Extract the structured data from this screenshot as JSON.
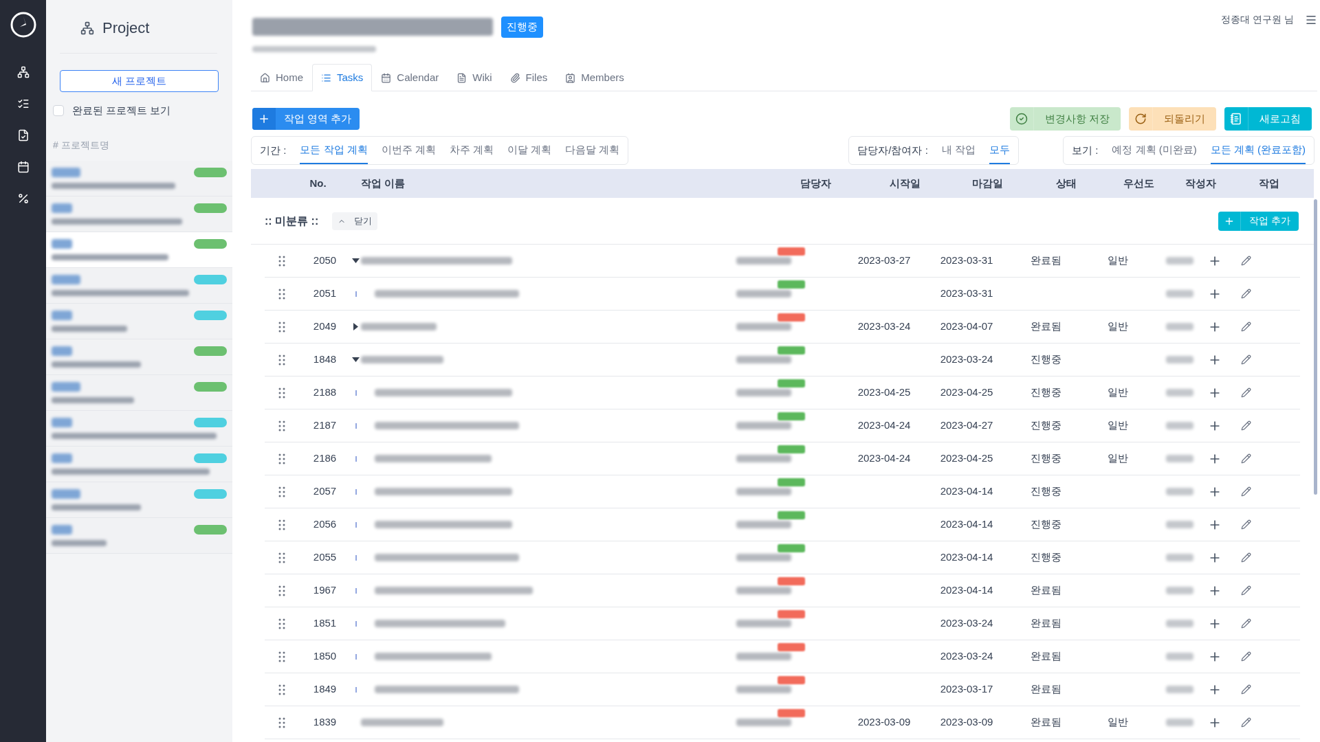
{
  "sidebar": {
    "title": "Project",
    "new_button": "새 프로젝트",
    "show_completed": {
      "label": "완료된 프로젝트 보기",
      "checked": false
    },
    "section": "# 프로젝트명",
    "projects": [
      {
        "color": "#6cc070",
        "selected": false
      },
      {
        "color": "#6cc070",
        "selected": false
      },
      {
        "color": "#6cc070",
        "selected": true
      },
      {
        "color": "#4fd0e0",
        "selected": false
      },
      {
        "color": "#4fd0e0",
        "selected": false
      },
      {
        "color": "#6cc070",
        "selected": false
      },
      {
        "color": "#6cc070",
        "selected": false
      },
      {
        "color": "#4fd0e0",
        "selected": false
      },
      {
        "color": "#4fd0e0",
        "selected": false
      },
      {
        "color": "#4fd0e0",
        "selected": false
      },
      {
        "color": "#6cc070",
        "selected": false
      }
    ]
  },
  "header": {
    "status_badge": "진행중",
    "user": "정종대 연구원 님"
  },
  "tabs": [
    {
      "kind": "home",
      "label": "Home",
      "selected": false
    },
    {
      "kind": "tasks",
      "label": "Tasks",
      "selected": true
    },
    {
      "kind": "calendar",
      "label": "Calendar",
      "selected": false
    },
    {
      "kind": "wiki",
      "label": "Wiki",
      "selected": false
    },
    {
      "kind": "files",
      "label": "Files",
      "selected": false
    },
    {
      "kind": "members",
      "label": "Members",
      "selected": false
    }
  ],
  "toolbar": {
    "add_area": "작업 영역 추가",
    "save": {
      "label": "변경사항 저장",
      "disabled": true
    },
    "revert": {
      "label": "되돌리기",
      "disabled": true
    },
    "refresh": {
      "label": "새로고침",
      "disabled": false
    }
  },
  "filters": {
    "period": {
      "label": "기간 :",
      "options": [
        {
          "label": "모든 작업 계획",
          "selected": true
        },
        {
          "label": "이번주 계획",
          "selected": false
        },
        {
          "label": "차주 계획",
          "selected": false
        },
        {
          "label": "이달 계획",
          "selected": false
        },
        {
          "label": "다음달 계획",
          "selected": false
        }
      ]
    },
    "assignee": {
      "label": "담당자/참여자 :",
      "options": [
        {
          "label": "내 작업",
          "selected": false
        },
        {
          "label": "모두",
          "selected": true
        }
      ]
    },
    "view": {
      "label": "보기 :",
      "options": [
        {
          "label": "예정 계획 (미완료)",
          "selected": false
        },
        {
          "label": "모든 계획 (완료포함)",
          "selected": true
        }
      ]
    }
  },
  "table": {
    "columns": [
      "No.",
      "작업 이름",
      "담당자",
      "시작일",
      "마감일",
      "상태",
      "우선도",
      "작성자",
      "작업"
    ],
    "group": {
      "title": ":: 미분류 ::",
      "toggle": "닫기",
      "add_task": "작업 추가"
    },
    "rows": [
      {
        "no": "2050",
        "kind": "expanded",
        "color": "#f26b5b",
        "start": "2023-03-27",
        "due": "2023-03-31",
        "status": "완료됨",
        "priority": "일반"
      },
      {
        "no": "2051",
        "kind": "child",
        "color": "#5cb85c",
        "due": "2023-03-31"
      },
      {
        "no": "2049",
        "kind": "collapsed",
        "color": "#f26b5b",
        "start": "2023-03-24",
        "due": "2023-04-07",
        "status": "완료됨",
        "priority": "일반"
      },
      {
        "no": "1848",
        "kind": "expanded",
        "color": "#5cb85c",
        "due": "2023-03-24",
        "status": "진행중"
      },
      {
        "no": "2188",
        "kind": "child",
        "color": "#5cb85c",
        "start": "2023-04-25",
        "due": "2023-04-25",
        "status": "진행중",
        "priority": "일반"
      },
      {
        "no": "2187",
        "kind": "child",
        "color": "#5cb85c",
        "start": "2023-04-24",
        "due": "2023-04-27",
        "status": "진행중",
        "priority": "일반"
      },
      {
        "no": "2186",
        "kind": "child",
        "color": "#5cb85c",
        "start": "2023-04-24",
        "due": "2023-04-25",
        "status": "진행중",
        "priority": "일반"
      },
      {
        "no": "2057",
        "kind": "child",
        "color": "#5cb85c",
        "due": "2023-04-14",
        "status": "진행중"
      },
      {
        "no": "2056",
        "kind": "child",
        "color": "#5cb85c",
        "due": "2023-04-14",
        "status": "진행중"
      },
      {
        "no": "2055",
        "kind": "child",
        "color": "#5cb85c",
        "due": "2023-04-14",
        "status": "진행중"
      },
      {
        "no": "1967",
        "kind": "child",
        "color": "#f26b5b",
        "due": "2023-04-14",
        "status": "완료됨"
      },
      {
        "no": "1851",
        "kind": "child",
        "color": "#f26b5b",
        "due": "2023-03-24",
        "status": "완료됨"
      },
      {
        "no": "1850",
        "kind": "child",
        "color": "#f26b5b",
        "due": "2023-03-24",
        "status": "완료됨"
      },
      {
        "no": "1849",
        "kind": "child",
        "color": "#f26b5b",
        "due": "2023-03-17",
        "status": "완료됨"
      },
      {
        "no": "1839",
        "kind": "none",
        "color": "#f26b5b",
        "start": "2023-03-09",
        "due": "2023-03-09",
        "status": "완료됨",
        "priority": "일반"
      }
    ]
  }
}
